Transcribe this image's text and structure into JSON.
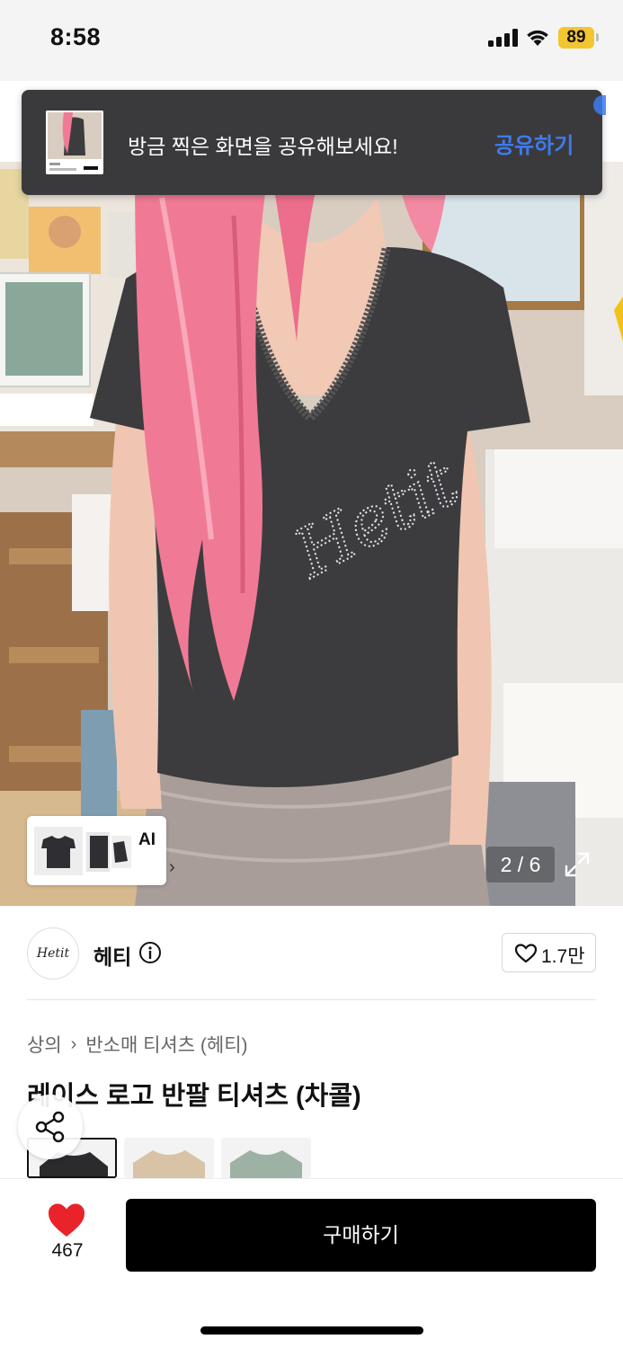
{
  "status_bar": {
    "time": "8:58",
    "battery": "89"
  },
  "toast": {
    "message": "방금 찍은 화면을 공유해보세요!",
    "action": "공유하기"
  },
  "gallery": {
    "counter": "2 / 6",
    "ai_label": "AI",
    "photo_text": "Hetit"
  },
  "store": {
    "name": "헤티",
    "logo_text": "Hetit",
    "likes": "1.7만"
  },
  "breadcrumb": [
    "상의",
    "반소매 티셔츠 (헤티)"
  ],
  "product": {
    "title": "레이스 로고 반팔 티셔츠 (차콜)"
  },
  "swatches": [
    {
      "color": "#2b2b2e",
      "selected": true
    },
    {
      "color": "#d8c3a6",
      "selected": false
    },
    {
      "color": "#9db2a4",
      "selected": false
    }
  ],
  "bottom_bar": {
    "wish_count": "467",
    "buy_label": "구매하기"
  },
  "colors": {
    "accent_blue": "#3d7bf0",
    "heart_red": "#e8232a",
    "battery_yellow": "#f2c531",
    "toast_bg": "#3a3a3c"
  },
  "icons": [
    "signal-icon",
    "wifi-icon",
    "battery-icon",
    "expand-icon",
    "info-icon",
    "heart-outline-icon",
    "share-icon",
    "heart-filled-icon",
    "chevron-right-icon"
  ]
}
